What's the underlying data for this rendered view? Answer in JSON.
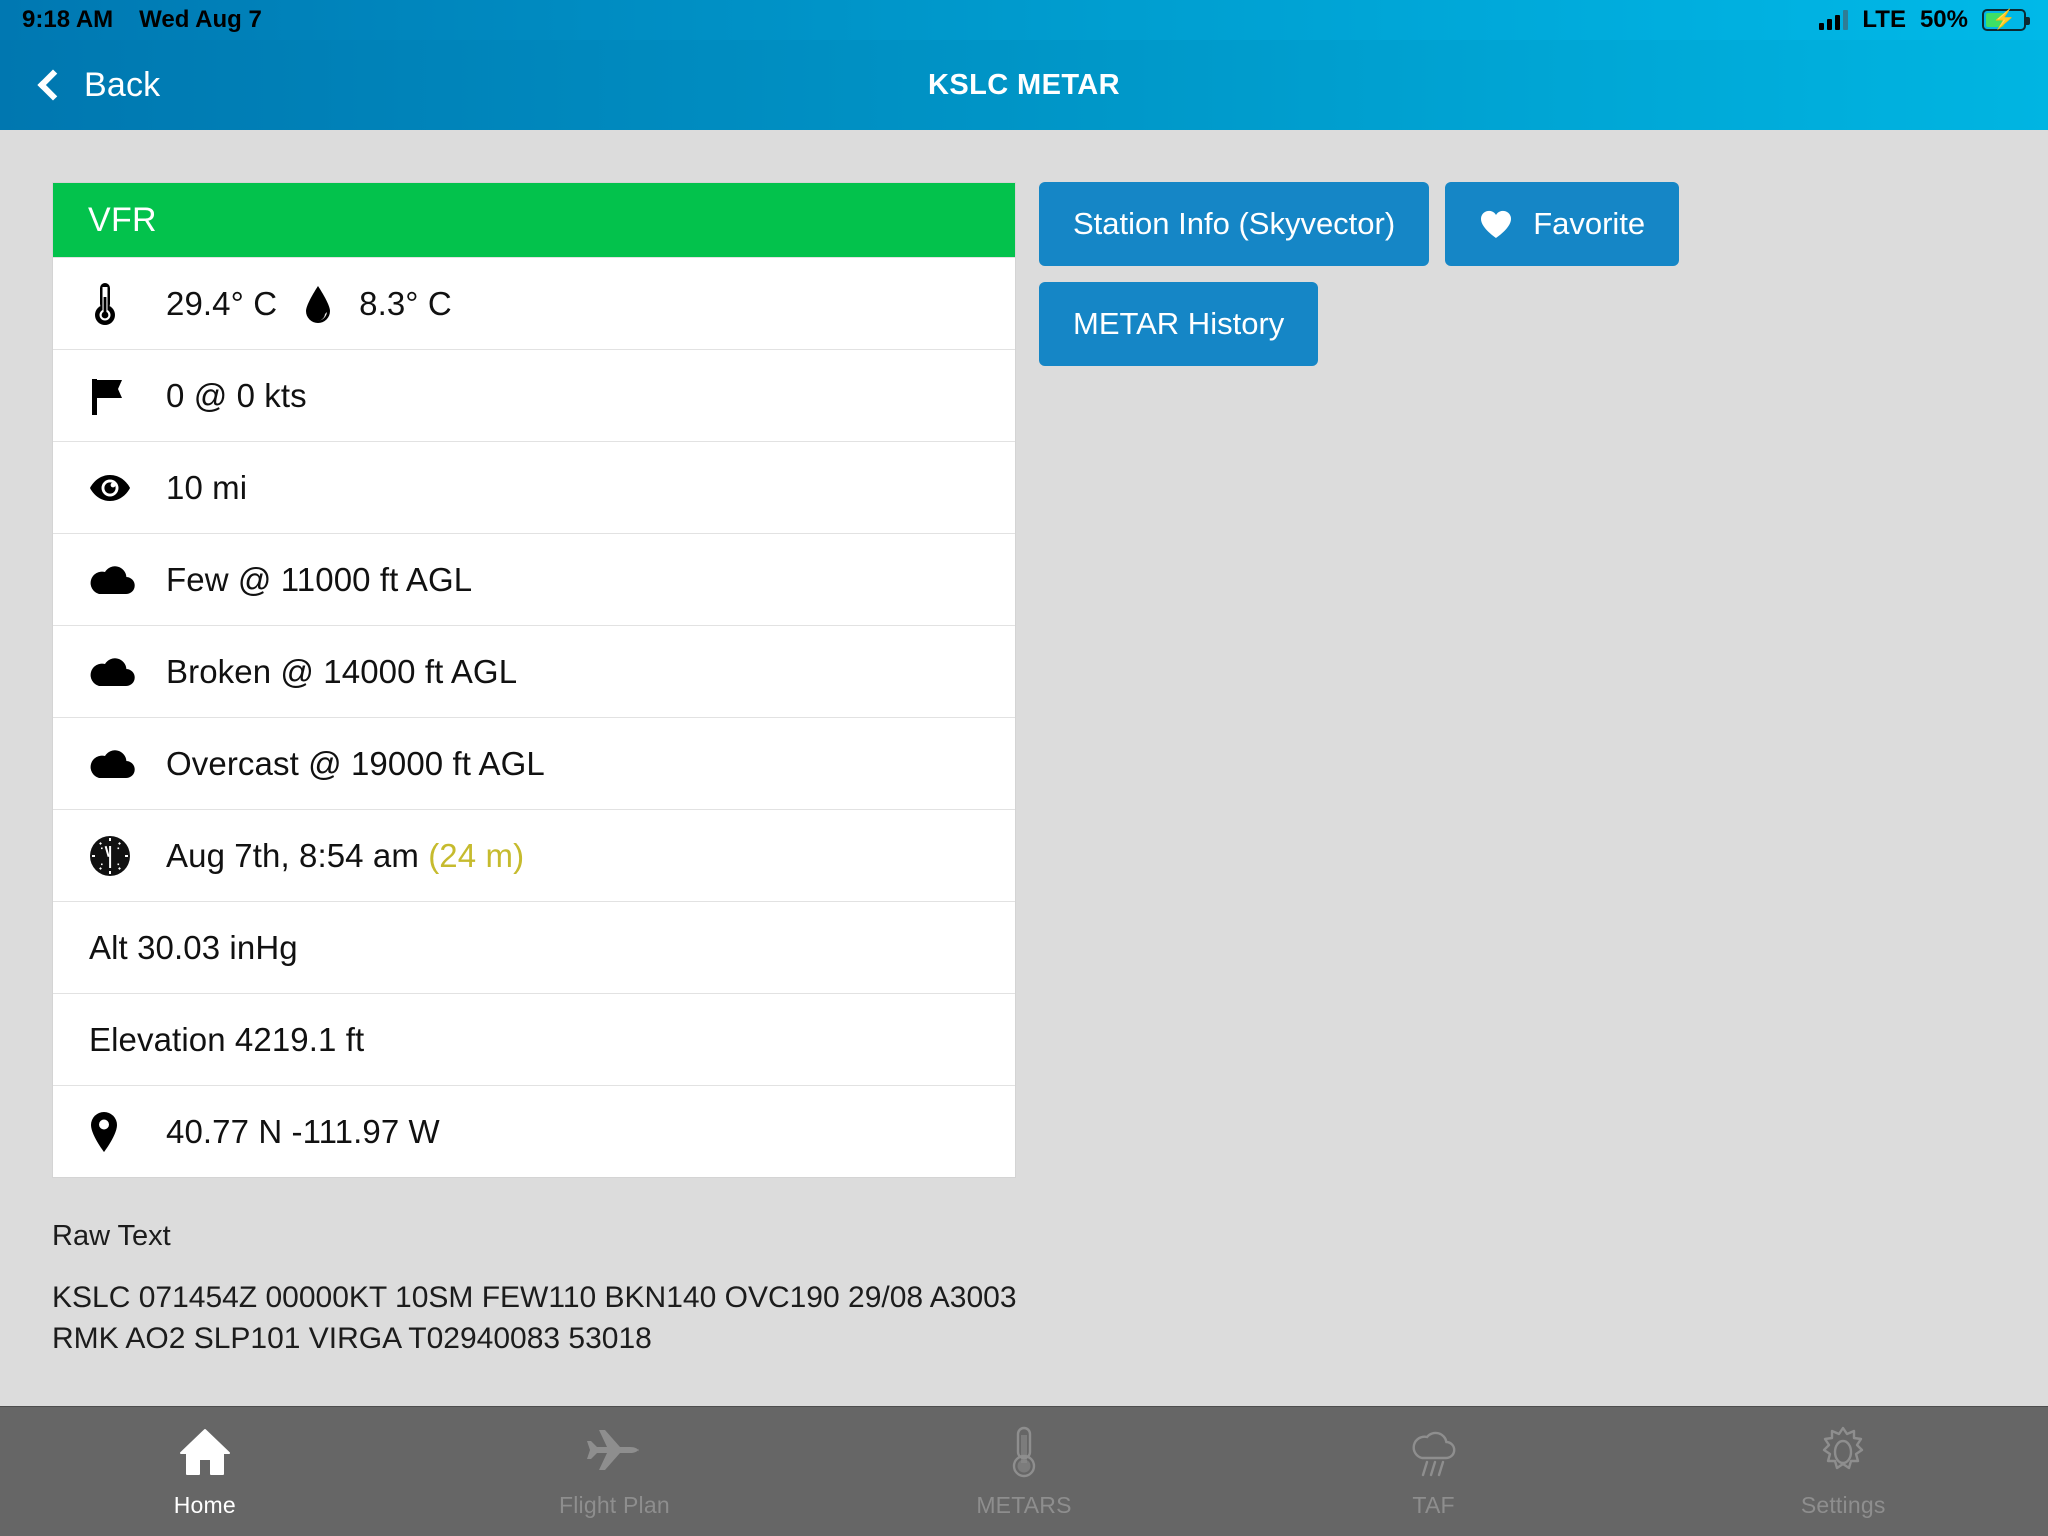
{
  "status_bar": {
    "time": "9:18 AM",
    "date": "Wed Aug 7",
    "network": "LTE",
    "battery_percent": "50%",
    "battery_level": 50,
    "charging": true
  },
  "nav": {
    "back_label": "Back",
    "title": "KSLC METAR"
  },
  "metar": {
    "flight_category": "VFR",
    "flight_category_color": "#03c24c",
    "rows": [
      {
        "icon": "thermometer-icon",
        "value": "29.4° C",
        "icon2": "dewpoint-droplet-icon",
        "value2": "8.3° C"
      },
      {
        "icon": "wind-flag-icon",
        "value": "0 @ 0 kts"
      },
      {
        "icon": "visibility-eye-icon",
        "value": "10 mi"
      },
      {
        "icon": "cloud-icon",
        "value": "Few @ 11000 ft AGL"
      },
      {
        "icon": "cloud-icon",
        "value": "Broken @ 14000 ft AGL"
      },
      {
        "icon": "cloud-icon",
        "value": "Overcast @ 19000 ft AGL"
      },
      {
        "icon": "clock-icon",
        "value": "Aug 7th, 8:54 am",
        "age": "(24 m)",
        "age_color": "#c6bb2e"
      },
      {
        "icon": null,
        "value": "Alt 30.03 inHg"
      },
      {
        "icon": null,
        "value": "Elevation 4219.1 ft"
      },
      {
        "icon": "location-pin-icon",
        "value": "40.77 N -111.97 W"
      }
    ]
  },
  "raw": {
    "label": "Raw Text",
    "text": "KSLC 071454Z 00000KT 10SM FEW110 BKN140 OVC190 29/08 A3003 RMK AO2 SLP101 VIRGA T02940083 53018"
  },
  "actions": {
    "accent_color": "#1586c6",
    "station_info": "Station Info (Skyvector)",
    "favorite": "Favorite",
    "metar_history": "METAR History"
  },
  "tabs": [
    {
      "label": "Home",
      "icon": "home-icon",
      "active": true
    },
    {
      "label": "Flight Plan",
      "icon": "airplane-icon",
      "active": false
    },
    {
      "label": "METARS",
      "icon": "thermometer-icon",
      "active": false
    },
    {
      "label": "TAF",
      "icon": "rain-cloud-icon",
      "active": false
    },
    {
      "label": "Settings",
      "icon": "gear-icon",
      "active": false
    }
  ]
}
